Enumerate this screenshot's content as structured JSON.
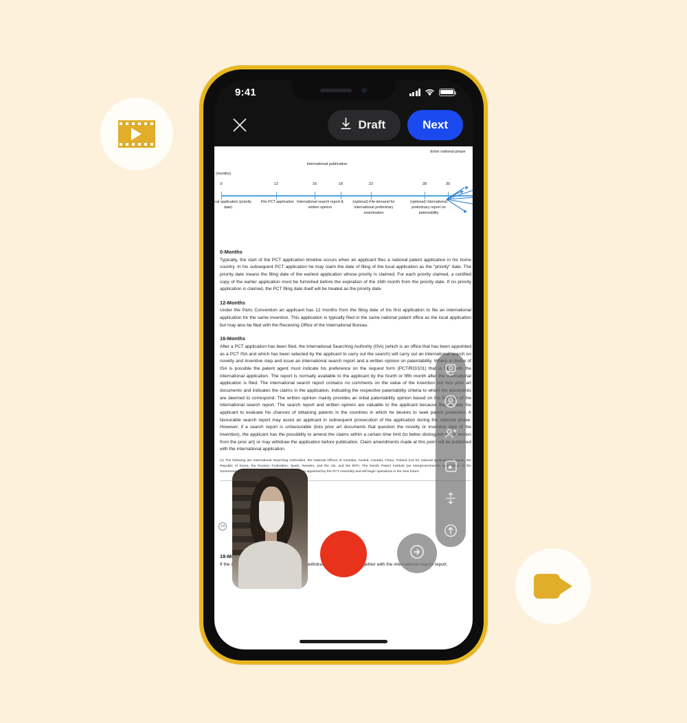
{
  "background_color": "#fdf1dc",
  "decorations": [
    {
      "name": "film-play-badge",
      "icon": "film-play-icon"
    },
    {
      "name": "video-camera-badge",
      "icon": "video-camera-icon"
    }
  ],
  "phone": {
    "frame_color": "#e8b71f",
    "bezel_color": "#0d0d0d",
    "status_bar": {
      "time": "9:41",
      "signal_icon": "cellular-signal-icon",
      "wifi_icon": "wifi-icon",
      "battery_icon": "battery-icon"
    },
    "app_bar": {
      "background": "#121212",
      "close_icon": "close-icon",
      "draft_label": "Draft",
      "draft_icon": "download-icon",
      "next_label": "Next",
      "next_color": "#1a49ef"
    }
  },
  "document": {
    "figure": {
      "axis_label": "(months)",
      "tick_labels": [
        "0",
        "12",
        "16",
        "18",
        "22",
        "28",
        "30"
      ],
      "above_labels": [
        {
          "text": "International publication"
        },
        {
          "text": "Enter national phase"
        }
      ],
      "below_labels": [
        "File local application (priority date)",
        "File PCT application",
        "International search report & written opinion",
        "(optional) File demand for international preliminary examination",
        "(optional) International preliminary report on patentability"
      ]
    },
    "sections": [
      {
        "heading": "0-Months",
        "body": "Typically, the start of the PCT application timeline occurs when an applicant files a national patent application in his home country. In his subsequent PCT application he may claim the date of filing of the local application as the \"priority\" date. The priority date means the filing date of the earliest application whose priority is claimed. For each priority claimed, a certified copy of the earlier application must be furnished before the expiration of the 16th month from the priority date. If no priority application is claimed, the PCT filing date itself will be treated as the priority date."
      },
      {
        "heading": "12-Months",
        "body": "Under the Paris Convention an applicant has 12 months from the filing date of his first application to file an international application for the same invention. This application is typically filed in the same national patent office as the local application but may also be filed with the Receiving Office of the International Bureau."
      },
      {
        "heading": "16-Months",
        "body": "After a PCT application has been filed, the International Searching Authority (ISA) (which is an office that has been appointed as a PCT ISA and which has been selected by the applicant to carry out the search) will carry out an international search on novelty and inventive step and issue an international search report and a written opinion on patentability. Where a choice of ISA is possible the patent agent must indicate his preference on the request form (PCT/RO/101) that is filed with the international application. The report is normally available to the applicant by the fourth or fifth month after the international application is filed. The international search report contains no comments on the value of the invention but lists prior art documents and indicates the claims in the application, indicating the respective patentability criteria to which the documents are deemed to correspond. The written opinion mainly provides an initial patentability opinion based on the findings of the international search report. The search report and written opinion are valuable to the applicant because they enable the applicant to evaluate his chances of obtaining patents in the countries in which he desires to seek patent protection. A favourable search report may assist an applicant in subsequent prosecution of the application during the national phase. However, if a search report is unfavourable (lists prior art documents that question the novelty or inventive step of the invention), the applicant has the possibility to amend the claims within a certain time limit (to better distinguish the invention from the prior art) or may withdraw the application before publication. Claim amendments made at this point will be published with the international application."
      },
      {
        "heading": "18-Months",
        "body": "If the international application has not been withdrawn it is published, together with the international search report."
      }
    ],
    "footnote": "(1) The following are International Searching Authorities: the National Offices of Australia, Austria, Canada, China, Finland (not for national applications), Japan, the Republic of Korea, the Russian Federation, Spain, Sweden, and the US, and the EPO. The Nordic Patent Institute (an intergovernmental organization of the Governments of Denmark, Iceland and Norway) has been appointed by the PCT Assembly and will begin operations in the near future.",
    "page_marker": "14"
  },
  "toolbar": {
    "items": [
      {
        "name": "switch-camera-icon",
        "label": "Switch camera"
      },
      {
        "name": "avatar-icon",
        "label": "Avatar"
      },
      {
        "name": "add-participant-sparkle-icon",
        "label": "Effects"
      },
      {
        "name": "layout-square-icon",
        "label": "Layout"
      },
      {
        "name": "resize-vertical-icon",
        "label": "Resize"
      },
      {
        "name": "upload-arrow-icon",
        "label": "Upload"
      }
    ]
  },
  "controls": {
    "record_button": {
      "name": "record-button",
      "color": "#e8321c"
    },
    "finish_button": {
      "name": "finish-recording-button",
      "icon": "exit-arrow-icon"
    },
    "pip_preview": {
      "name": "webcam-pip-preview"
    }
  }
}
